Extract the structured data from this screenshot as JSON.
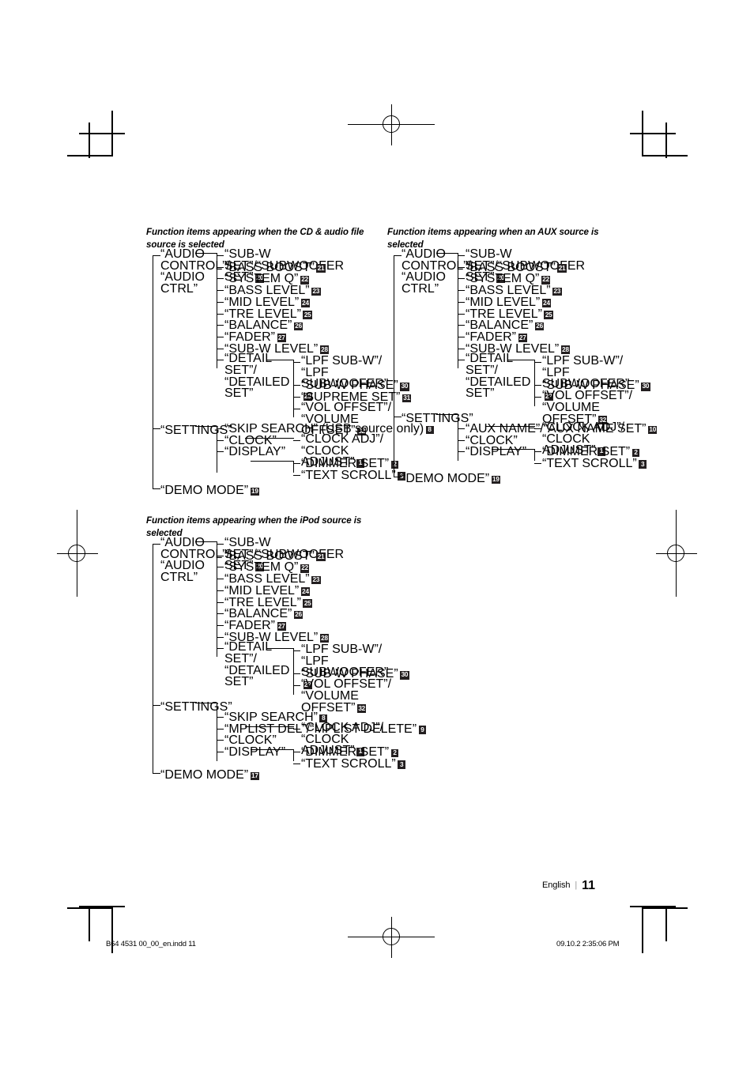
{
  "footer": {
    "language": "English",
    "separator": "|",
    "page_number": "11",
    "slug_left": "B64 4531 00_00_en.indd   11",
    "slug_right": "09.10.2   2:35:06 PM"
  },
  "blocks": [
    {
      "id": "cd-audio",
      "title": "Function items appearing when the CD & audio file source is selected",
      "root_items": [
        {
          "label": "“AUDIO CONTROL”/ “AUDIO CTRL”"
        },
        {
          "label": "“SETTINGS”"
        },
        {
          "label": "“DEMO MODE”",
          "badge": "19"
        }
      ],
      "audio_items": [
        {
          "label": "“SUB-W SET”/“SUBWOOFER SET”",
          "badge": "20"
        },
        {
          "label": "“BASS BOOST”",
          "badge": "21"
        },
        {
          "label": "“SYSTEM Q”",
          "badge": "22"
        },
        {
          "label": "“BASS LEVEL”",
          "badge": "23"
        },
        {
          "label": "“MID LEVEL”",
          "badge": "24"
        },
        {
          "label": "“TRE LEVEL”",
          "badge": "25"
        },
        {
          "label": "“BALANCE”",
          "badge": "26"
        },
        {
          "label": "“FADER”",
          "badge": "27"
        },
        {
          "label": "“SUB-W LEVEL”",
          "badge": "28"
        },
        {
          "label": "“DETAIL SET”/ “DETAILED SET”"
        }
      ],
      "detail_items": [
        {
          "label": "“LPF SUB-W”/ “LPF SUBWOOFER”",
          "badge": "29"
        },
        {
          "label": "“SUB-W PHASE”",
          "badge": "30"
        },
        {
          "label": "“SUPREME SET”",
          "badge": "31"
        },
        {
          "label": "“VOL OFFSET”/ “VOLUME OFFSET”",
          "badge": "32"
        }
      ],
      "settings_items": [
        {
          "label": "“SKIP SEARCH” (USB source only)",
          "badge": "8"
        },
        {
          "label": "“CLOCK”"
        },
        {
          "label": "“DISPLAY”"
        }
      ],
      "clock_items": [
        {
          "label": "“CLOCK ADJ”/ “CLOCK ADJUST”",
          "badge": "1"
        }
      ],
      "display_items": [
        {
          "label": "“DIMMER SET”",
          "badge": "2"
        },
        {
          "label": "“TEXT SCROLL”",
          "badge": "3"
        }
      ]
    },
    {
      "id": "aux",
      "title": "Function items appearing when an AUX source is selected",
      "root_items": [
        {
          "label": "“AUDIO CONTROL”/ “AUDIO CTRL”"
        },
        {
          "label": "“SETTINGS”"
        },
        {
          "label": "“DEMO MODE”",
          "badge": "19"
        }
      ],
      "audio_items": [
        {
          "label": "“SUB-W SET”/“SUBWOOFER SET”",
          "badge": "20"
        },
        {
          "label": "“BASS BOOST”",
          "badge": "21"
        },
        {
          "label": "“SYSTEM Q”",
          "badge": "22"
        },
        {
          "label": "“BASS LEVEL”",
          "badge": "23"
        },
        {
          "label": "“MID LEVEL”",
          "badge": "24"
        },
        {
          "label": "“TRE LEVEL”",
          "badge": "25"
        },
        {
          "label": "“BALANCE”",
          "badge": "26"
        },
        {
          "label": "“FADER”",
          "badge": "27"
        },
        {
          "label": "“SUB-W LEVEL”",
          "badge": "28"
        },
        {
          "label": "“DETAIL SET”/ “DETAILED SET”"
        }
      ],
      "detail_items": [
        {
          "label": "“LPF SUB-W”/ “LPF SUBWOOFER”",
          "badge": "29"
        },
        {
          "label": "“SUB-W PHASE”",
          "badge": "30"
        },
        {
          "label": "“VOL OFFSET”/ “VOLUME OFFSET”",
          "badge": "32"
        }
      ],
      "settings_items": [
        {
          "label": "“AUX NAME”/“AUX NAME SET”",
          "badge": "10"
        },
        {
          "label": "“CLOCK”"
        },
        {
          "label": "“DISPLAY”"
        }
      ],
      "clock_items": [
        {
          "label": "“CLOCK ADJ”/ “CLOCK ADJUST”",
          "badge": "1"
        }
      ],
      "display_items": [
        {
          "label": "“DIMMER SET”",
          "badge": "2"
        },
        {
          "label": "“TEXT SCROLL”",
          "badge": "3"
        }
      ]
    },
    {
      "id": "ipod",
      "title": "Function items appearing when the iPod source is selected",
      "root_items": [
        {
          "label": "“AUDIO CONTROL”/ “AUDIO CTRL”"
        },
        {
          "label": "“SETTINGS”"
        },
        {
          "label": "“DEMO MODE”",
          "badge": "17"
        }
      ],
      "audio_items": [
        {
          "label": "“SUB-W SET”/“SUBWOOFER SET”",
          "badge": "20"
        },
        {
          "label": "“BASS BOOST”",
          "badge": "21"
        },
        {
          "label": "“SYSTEM Q”",
          "badge": "22"
        },
        {
          "label": "“BASS LEVEL”",
          "badge": "23"
        },
        {
          "label": "“MID LEVEL”",
          "badge": "24"
        },
        {
          "label": "“TRE LEVEL”",
          "badge": "25"
        },
        {
          "label": "“BALANCE”",
          "badge": "26"
        },
        {
          "label": "“FADER”",
          "badge": "27"
        },
        {
          "label": "“SUB-W LEVEL”",
          "badge": "28"
        },
        {
          "label": "“DETAIL SET”/ “DETAILED SET”"
        }
      ],
      "detail_items": [
        {
          "label": "“LPF SUB-W”/ “LPF SUBWOOFER”",
          "badge": "29"
        },
        {
          "label": "“SUB-W PHASE”",
          "badge": "30"
        },
        {
          "label": "“VOL OFFSET”/ “VOLUME OFFSET”",
          "badge": "32"
        }
      ],
      "settings_items": [
        {
          "label": "“SKIP SEARCH”",
          "badge": "8"
        },
        {
          "label": "“MPLIST DEL”/“MPLIST DELETE”",
          "badge": "9"
        },
        {
          "label": "“CLOCK”"
        },
        {
          "label": "“DISPLAY”"
        }
      ],
      "clock_items": [
        {
          "label": "“CLOCK ADJ”/ “CLOCK ADJUST”",
          "badge": "1"
        }
      ],
      "display_items": [
        {
          "label": "“DIMMER SET”",
          "badge": "2"
        },
        {
          "label": "“TEXT SCROLL”",
          "badge": "3"
        }
      ]
    }
  ],
  "colors": {
    "badge_bg": "#231f20",
    "badge_fg": "#ffffff",
    "ink": "#000000"
  }
}
